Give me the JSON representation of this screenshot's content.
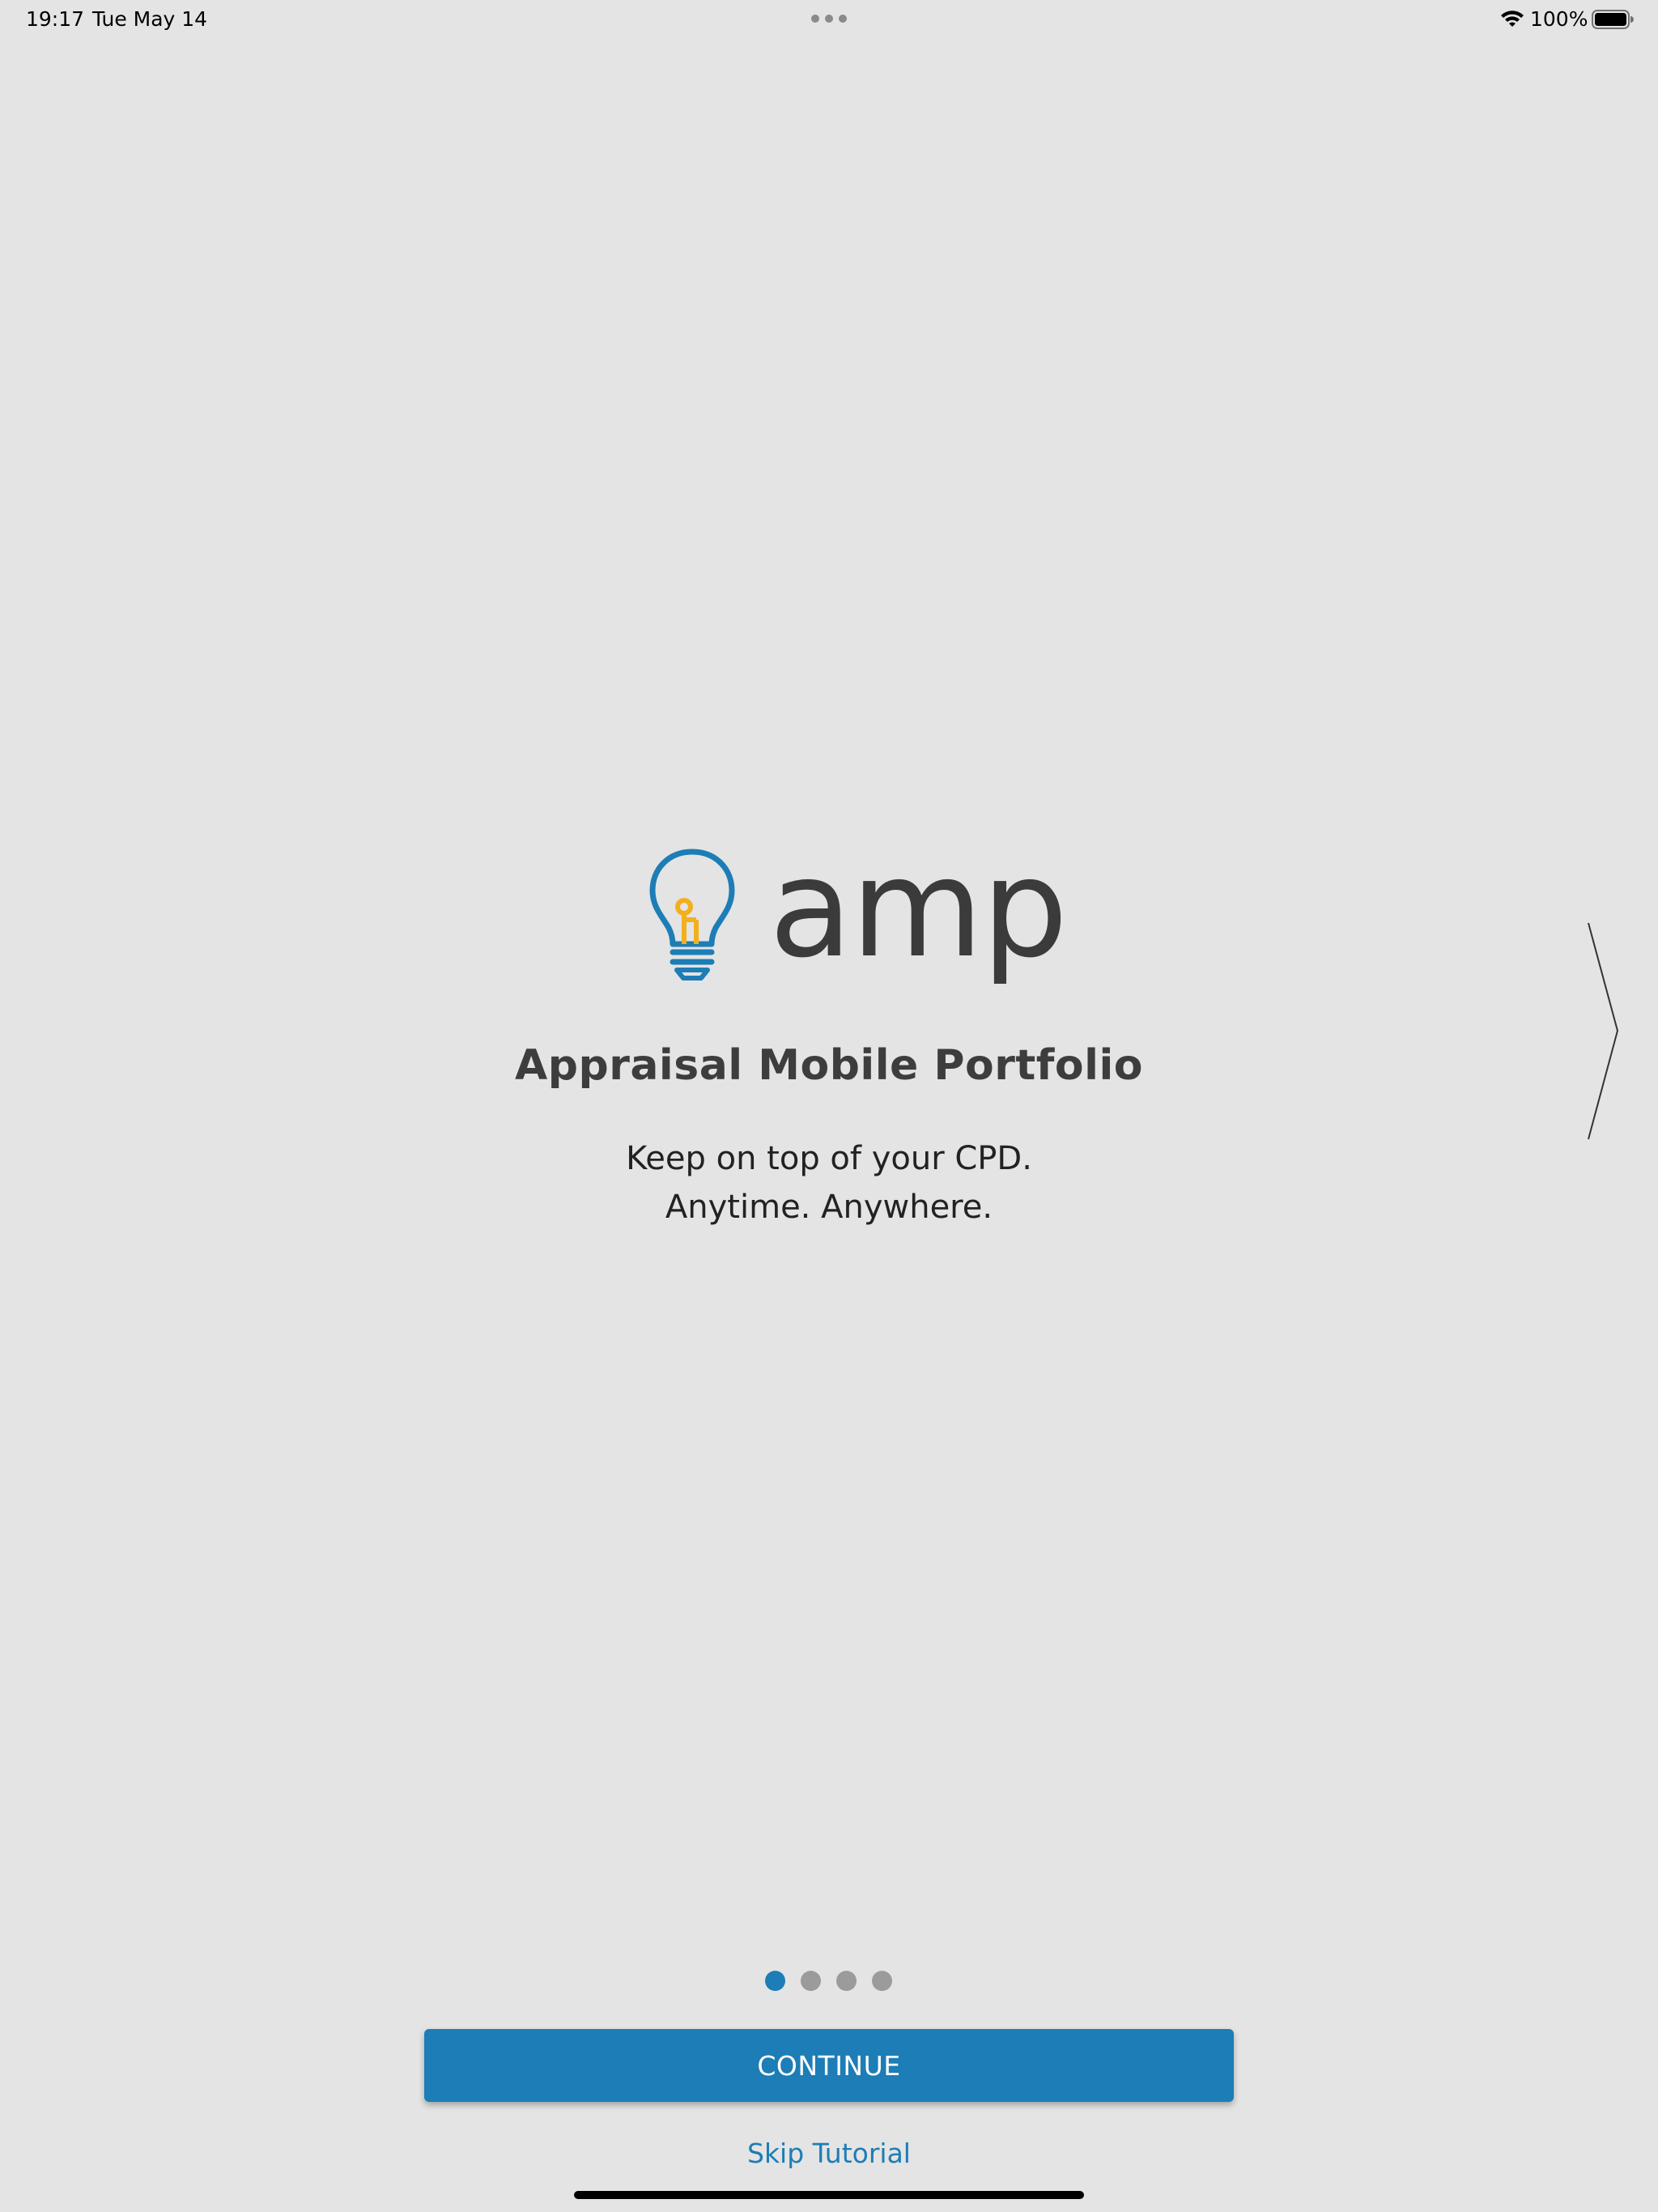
{
  "status_bar": {
    "time": "19:17",
    "date": "Tue May 14",
    "battery": "100%"
  },
  "logo": {
    "wordmark": "amp",
    "icon": "lightbulb-icon"
  },
  "onboarding": {
    "title": "Appraisal Mobile Portfolio",
    "tagline_line1": "Keep on top of your CPD.",
    "tagline_line2": "Anytime. Anywhere.",
    "page_count": 4,
    "current_page": 1
  },
  "actions": {
    "continue_label": "CONTINUE",
    "skip_label": "Skip Tutorial"
  },
  "colors": {
    "accent": "#1d7db6",
    "bulb_filament": "#f2b01e",
    "background": "#e4e4e4",
    "text": "#3d3d3d"
  }
}
